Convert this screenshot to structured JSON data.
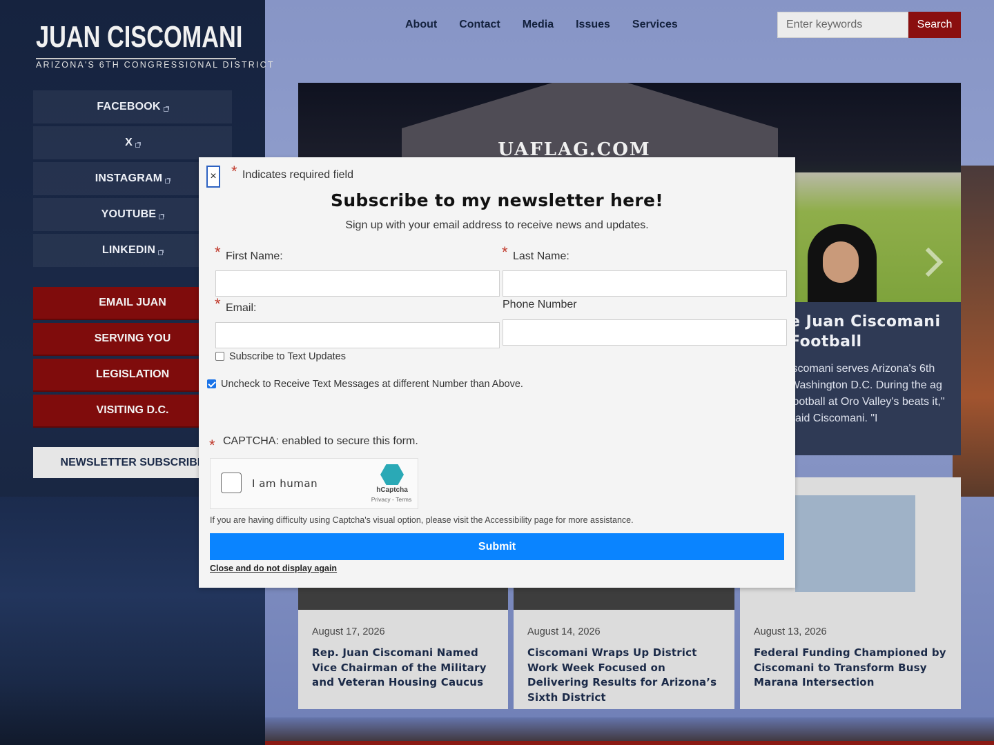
{
  "site": {
    "logo_name": "JUAN CISCOMANI",
    "logo_sub": "ARIZONA'S 6TH CONGRESSIONAL DISTRICT"
  },
  "social": [
    {
      "label": "FACEBOOK",
      "icon": "external-link-icon"
    },
    {
      "label": "X",
      "icon": "external-link-icon"
    },
    {
      "label": "INSTAGRAM",
      "icon": "external-link-icon"
    },
    {
      "label": "YOUTUBE",
      "icon": "external-link-icon"
    },
    {
      "label": "LINKEDIN",
      "icon": "external-link-icon"
    }
  ],
  "actions": [
    {
      "label": "EMAIL JUAN"
    },
    {
      "label": "SERVING YOU"
    },
    {
      "label": "LEGISLATION"
    },
    {
      "label": "VISITING D.C."
    }
  ],
  "newsletter_button": "NEWSLETTER SUBSCRIBE",
  "nav": {
    "items": [
      "About",
      "Contact",
      "Media",
      "Issues",
      "Services"
    ]
  },
  "search": {
    "placeholder": "Enter keywords",
    "button": "Search"
  },
  "hero": {
    "tent_text": "UAFLAG.COM",
    "title": "e Juan Ciscomani Football",
    "body": "iscomani serves Arizona's 6th Washington D.C. During the ag football at Oro Valley's beats it,\" said Ciscomani. \"I"
  },
  "news": [
    {
      "date": "August 17, 2026",
      "title": "Rep. Juan Ciscomani Named Vice Chairman of the Military and Veteran Housing Caucus"
    },
    {
      "date": "August 14, 2026",
      "title": "Ciscomani Wraps Up District Work Week Focused on Delivering Results for Arizona’s Sixth District"
    },
    {
      "date": "August 13, 2026",
      "title": "Federal Funding Championed by Ciscomani to Transform Busy Marana Intersection"
    }
  ],
  "modal": {
    "close_symbol": "×",
    "required_star": "*",
    "required_note": "Indicates required field",
    "title": "Subscribe to my newsletter here!",
    "subtitle": "Sign up with your email address to receive news and updates.",
    "first_name_label": "First Name:",
    "last_name_label": "Last Name:",
    "email_label": "Email:",
    "phone_label": "Phone Number",
    "text_updates_label": "Subscribe to Text Updates",
    "text_updates_checked": false,
    "different_number_label": "Uncheck to Receive Text Messages at different Number than Above.",
    "different_number_checked": true,
    "captcha_label": "CAPTCHA: enabled to secure this form.",
    "captcha_text": "I am human",
    "captcha_brand": "hCaptcha",
    "captcha_links": "Privacy - Terms",
    "captcha_help": "If you are having difficulty using Captcha's visual option, please visit the Accessibility page for more assistance.",
    "submit": "Submit",
    "close_again": "Close and do not display again"
  },
  "colors": {
    "sidebar_bg": "#1b2a48",
    "action_red": "#7f0c0c",
    "search_red": "#8a0f0f",
    "submit_blue": "#0a84ff",
    "required_red": "#c0392b"
  }
}
